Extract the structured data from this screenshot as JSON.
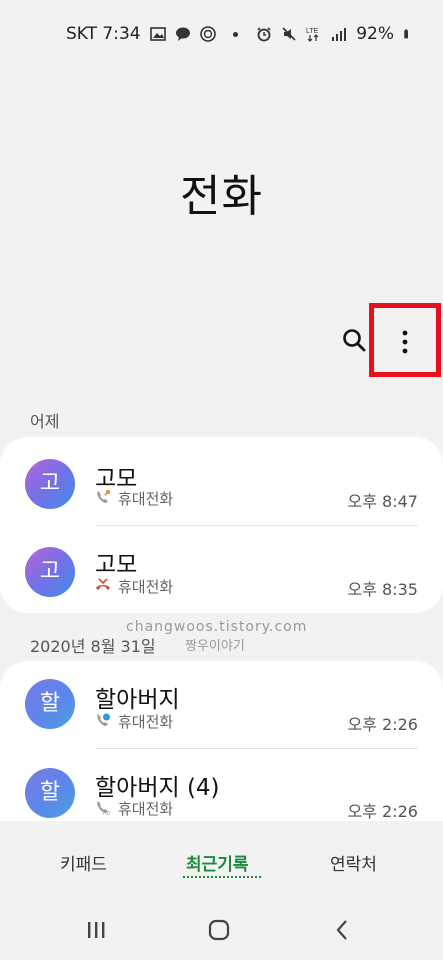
{
  "status_bar": {
    "carrier_time": "SKT 7:34",
    "battery": "92%"
  },
  "title": "전화",
  "sections": [
    {
      "label": "어제",
      "calls": [
        {
          "avatar": "고",
          "name": "고모",
          "type": "휴대전화",
          "time": "오후 8:47",
          "call_icon": "outgoing-call-icon"
        },
        {
          "avatar": "고",
          "name": "고모",
          "type": "휴대전화",
          "time": "오후 8:35",
          "call_icon": "missed-call-icon"
        }
      ]
    },
    {
      "label": "2020년 8월 31일",
      "calls": [
        {
          "avatar": "할",
          "name": "할아버지",
          "type": "휴대전화",
          "time": "오후 2:26",
          "call_icon": "video-call-icon"
        },
        {
          "avatar": "할",
          "name": "할아버지 (4)",
          "type": "휴대전화",
          "time": "오후 2:26",
          "call_icon": "hd-call-icon"
        }
      ]
    }
  ],
  "watermark": {
    "line1": "changwoos.tistory.com",
    "line2": "짱우이야기"
  },
  "tabs": [
    {
      "label": "키패드",
      "active": false
    },
    {
      "label": "최근기록",
      "active": true
    },
    {
      "label": "연락처",
      "active": false
    }
  ],
  "colors": {
    "active_tab": "#1e8a3e",
    "highlight": "#e8101a",
    "missed": "#d9482b"
  }
}
